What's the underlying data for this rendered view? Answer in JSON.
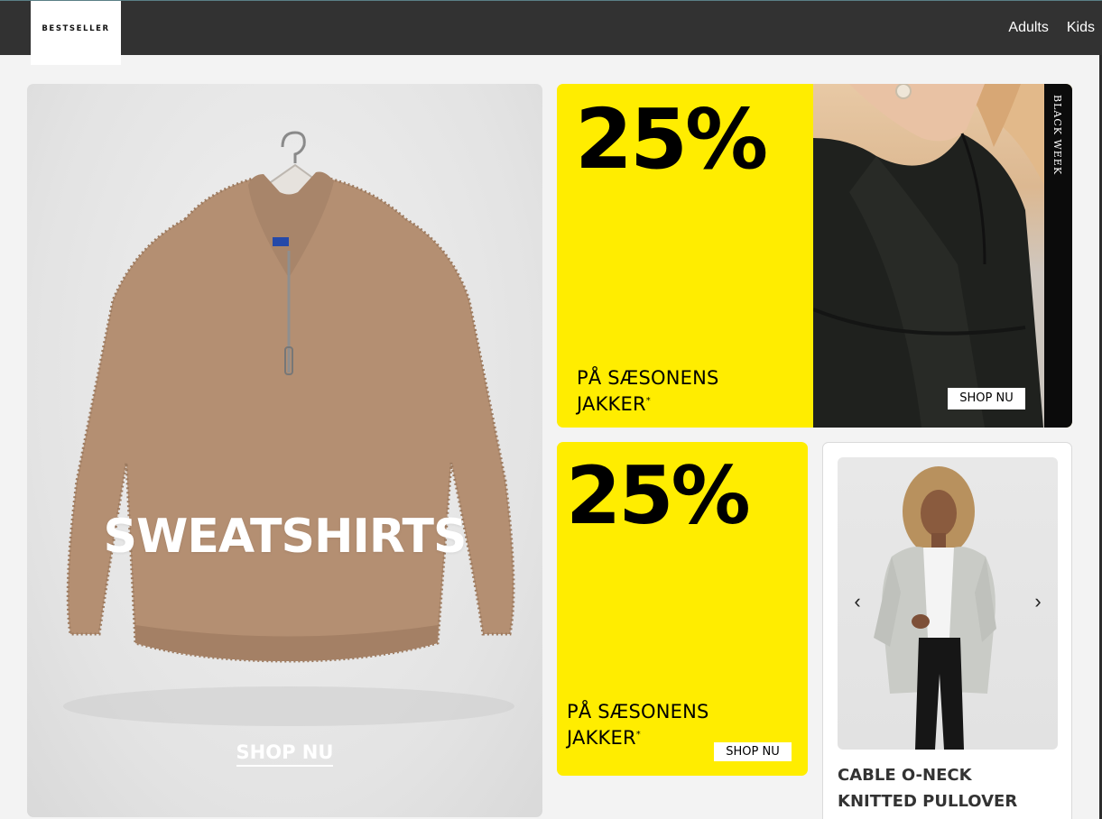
{
  "header": {
    "logo": "BESTSELLER",
    "nav": [
      "Adults",
      "Kids"
    ]
  },
  "hero": {
    "title": "SWEATSHIRTS",
    "cta": "SHOP NU"
  },
  "promo_top": {
    "percent": "25%",
    "text_line1": "PÅ SÆSONENS",
    "text_line2": "JAKKER",
    "asterisk": "*",
    "badge": "BLACK WEEK",
    "cta": "SHOP NU"
  },
  "promo_bottom": {
    "percent": "25%",
    "text_line1": "PÅ SÆSONENS",
    "text_line2": "JAKKER",
    "asterisk": "*",
    "cta": "SHOP NU"
  },
  "product": {
    "name": "CABLE O-NECK KNITTED PULLOVER",
    "prev": "‹",
    "next": "›"
  },
  "colors": {
    "header_bg": "#323232",
    "promo_yellow": "#ffed00"
  }
}
